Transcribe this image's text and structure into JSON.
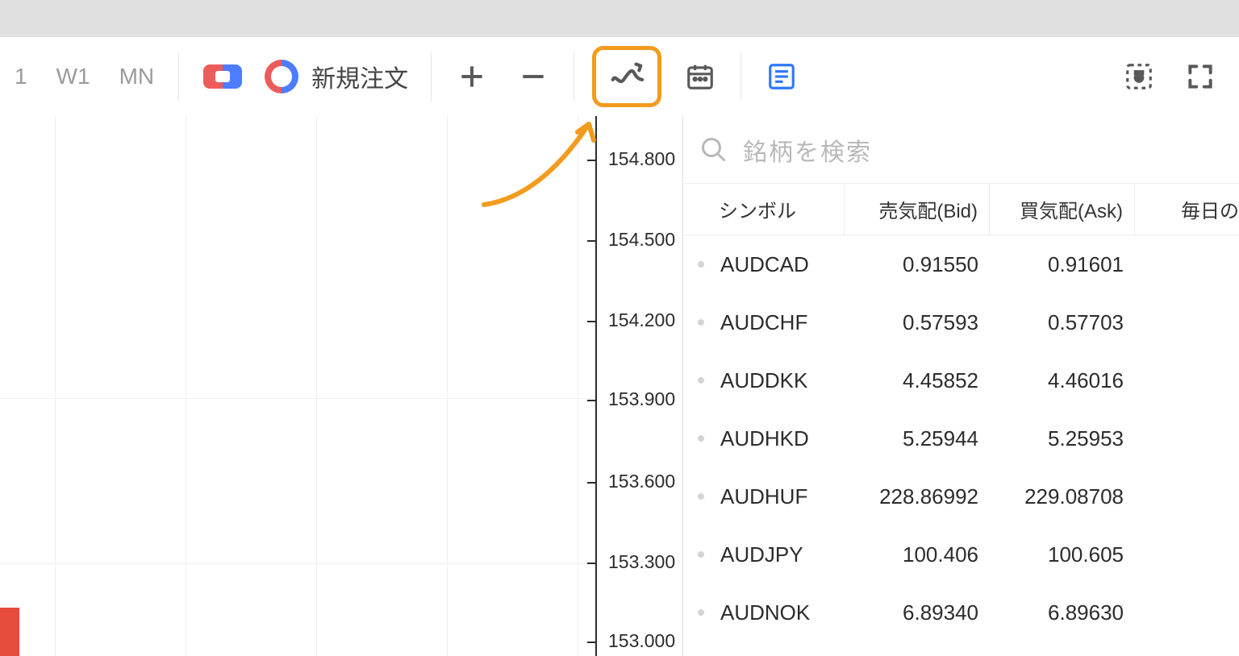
{
  "toolbar": {
    "timeframes": [
      "1",
      "W1",
      "MN"
    ],
    "new_order_label": "新規注文"
  },
  "chart": {
    "y_ticks": [
      "154.800",
      "154.500",
      "154.200",
      "153.900",
      "153.600",
      "153.300",
      "153.000"
    ]
  },
  "watchlist": {
    "search_placeholder": "銘柄を検索",
    "headers": {
      "symbol": "シンボル",
      "bid": "売気配(Bid)",
      "ask": "買気配(Ask)",
      "daily": "毎日の"
    },
    "rows": [
      {
        "symbol": "AUDCAD",
        "bid": "0.91550",
        "ask": "0.91601"
      },
      {
        "symbol": "AUDCHF",
        "bid": "0.57593",
        "ask": "0.57703"
      },
      {
        "symbol": "AUDDKK",
        "bid": "4.45852",
        "ask": "4.46016"
      },
      {
        "symbol": "AUDHKD",
        "bid": "5.25944",
        "ask": "5.25953"
      },
      {
        "symbol": "AUDHUF",
        "bid": "228.86992",
        "ask": "229.08708"
      },
      {
        "symbol": "AUDJPY",
        "bid": "100.406",
        "ask": "100.605"
      },
      {
        "symbol": "AUDNOK",
        "bid": "6.89340",
        "ask": "6.89630"
      }
    ]
  }
}
